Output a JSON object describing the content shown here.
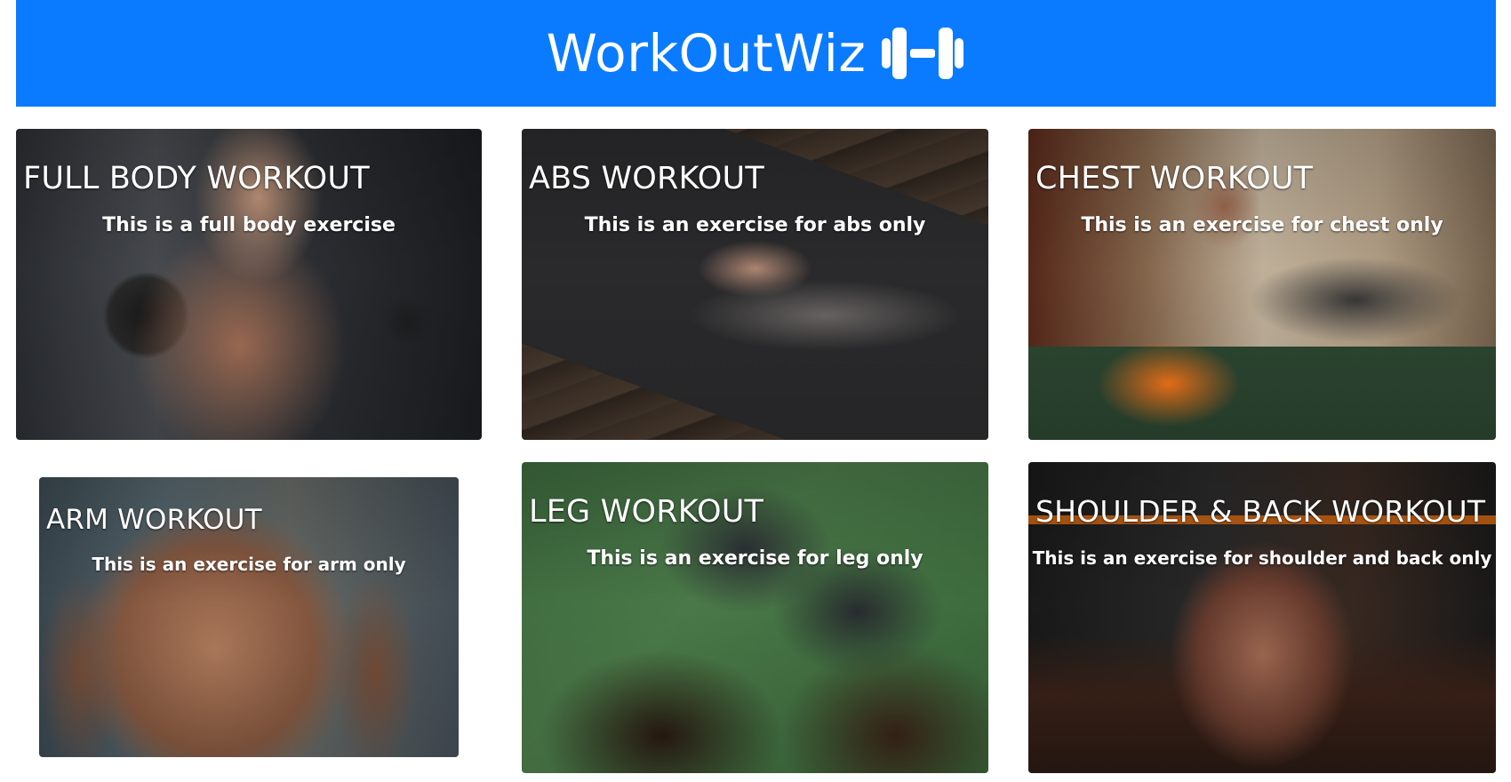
{
  "header": {
    "title": "WorkOutWiz",
    "icon": "dumbbell-icon",
    "background": "#0a7bff"
  },
  "cards": [
    {
      "title": "FULL BODY WORKOUT",
      "description": "This is a full body exercise"
    },
    {
      "title": "ABS WORKOUT",
      "description": "This is an exercise for abs only"
    },
    {
      "title": "CHEST WORKOUT",
      "description": "This is an exercise for chest only"
    },
    {
      "title": "ARM WORKOUT",
      "description": "This is an exercise for arm only"
    },
    {
      "title": "LEG WORKOUT",
      "description": "This is an exercise for leg only"
    },
    {
      "title": "SHOULDER & BACK WORKOUT",
      "description": "This is an exercise for shoulder and back only"
    }
  ]
}
